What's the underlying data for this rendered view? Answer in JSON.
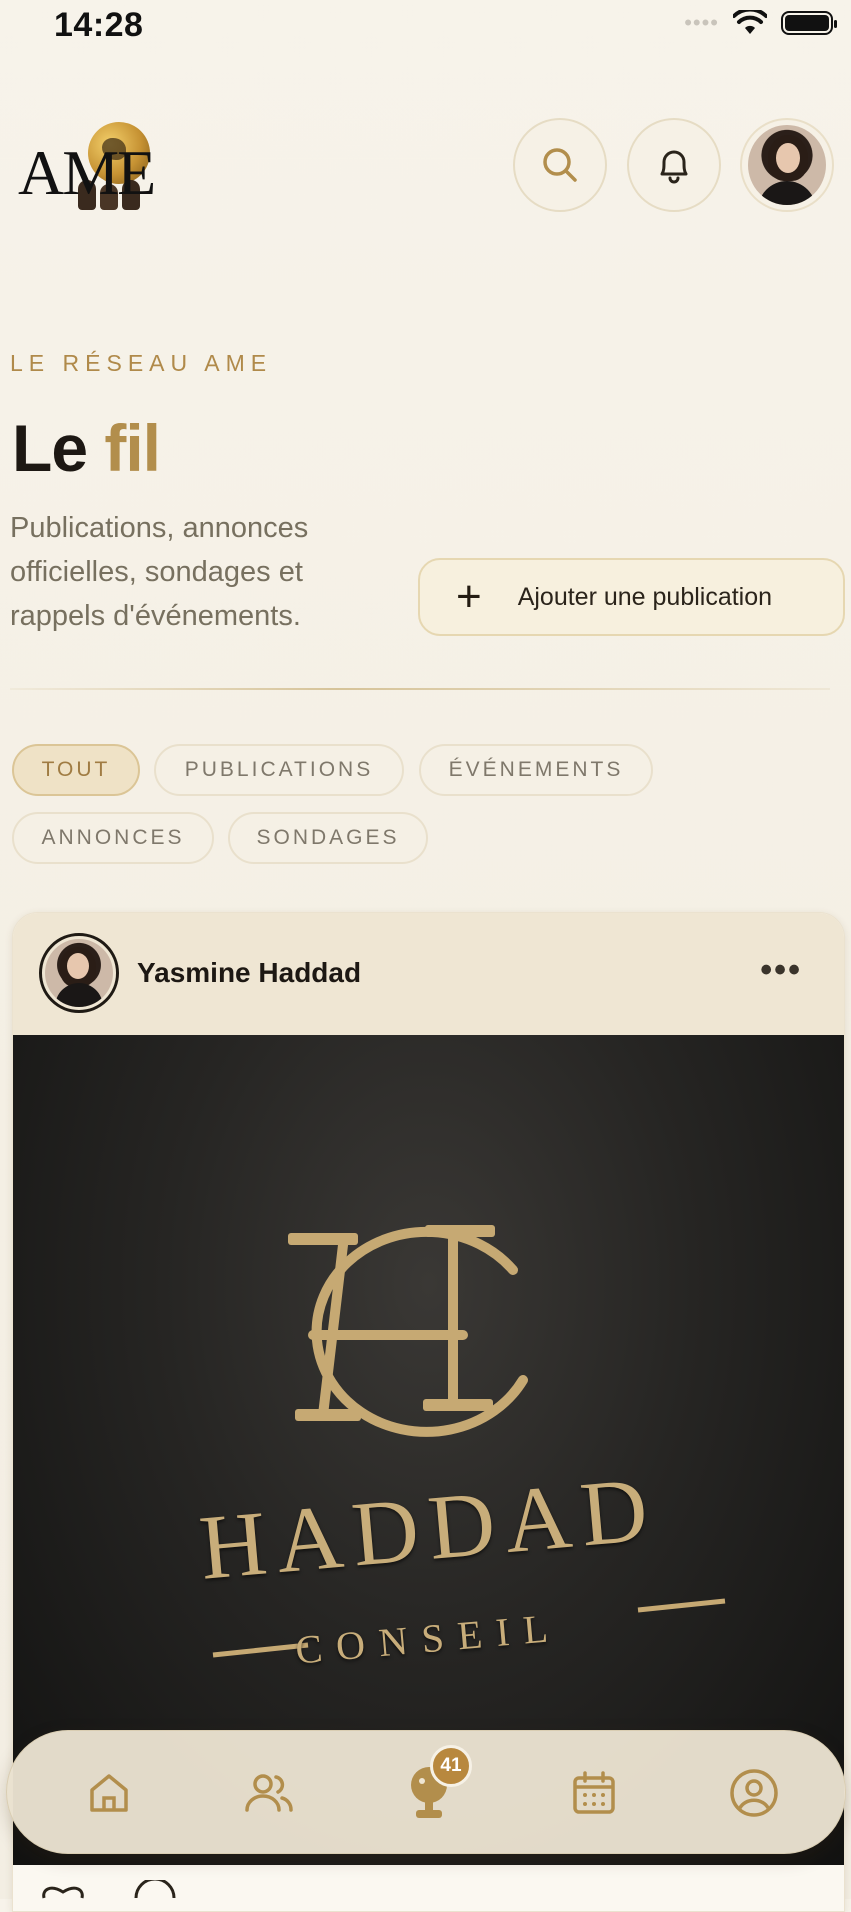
{
  "status_bar": {
    "time": "14:28"
  },
  "header": {
    "logo_text": "AME",
    "search_icon": "search-icon",
    "notifications_icon": "bell-icon"
  },
  "hero": {
    "eyebrow": "LE RÉSEAU AME",
    "title_plain": "Le ",
    "title_accent": "fil",
    "subtitle": "Publications, annonces officielles, sondages et rappels d'événements.",
    "add_button_label": "Ajouter une publication"
  },
  "filters": [
    {
      "label": "TOUT",
      "active": true
    },
    {
      "label": "PUBLICATIONS",
      "active": false
    },
    {
      "label": "ÉVÉNEMENTS",
      "active": false
    },
    {
      "label": "ANNONCES",
      "active": false
    },
    {
      "label": "SONDAGES",
      "active": false
    }
  ],
  "post": {
    "author": "Yasmine Haddad",
    "menu_label": "•••",
    "image": {
      "brand_name": "HADDAD",
      "brand_sub": "CONSEIL"
    }
  },
  "tabbar": {
    "tabs": [
      "home-icon",
      "members-icon",
      "chat-icon",
      "calendar-icon",
      "profile-icon"
    ],
    "badge_count": "41"
  },
  "colors": {
    "accent": "#b28e4c",
    "background": "#f5f0e6",
    "ink": "#1d1813"
  }
}
